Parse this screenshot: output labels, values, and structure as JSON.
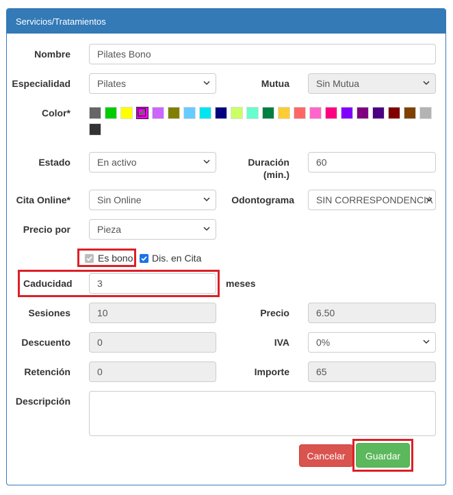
{
  "panel": {
    "title": "Servicios/Tratamientos"
  },
  "form": {
    "nombre": {
      "label": "Nombre",
      "value": "Pilates Bono"
    },
    "especialidad": {
      "label": "Especialidad",
      "value": "Pilates"
    },
    "mutua": {
      "label": "Mutua",
      "value": "Sin Mutua"
    },
    "color": {
      "label": "Color*",
      "selected": "#ff00ff",
      "swatches": [
        "#666666",
        "#00cc00",
        "#ffff00",
        "#ff00ff",
        "#cc66ff",
        "#808000",
        "#66ccff",
        "#00e5ee",
        "#000080",
        "#ccff66",
        "#66ffcc",
        "#008040",
        "#ffcc33",
        "#ff6666",
        "#ff66cc",
        "#ff0080",
        "#8000ff",
        "#800080",
        "#4b0082",
        "#800000",
        "#804000",
        "#b3b3b3",
        "#333333"
      ]
    },
    "estado": {
      "label": "Estado",
      "value": "En activo"
    },
    "duracion": {
      "label_line1": "Duración",
      "label_line2": "(min.)",
      "value": "60"
    },
    "cita_online": {
      "label": "Cita Online*",
      "value": "Sin Online"
    },
    "odontograma": {
      "label": "Odontograma",
      "value": "SIN CORRESPONDENCIA"
    },
    "precio_por": {
      "label": "Precio por",
      "value": "Pieza"
    },
    "es_bono": {
      "label": "Es bono",
      "checked": true
    },
    "dis_en_cita": {
      "label": "Dis. en Cita",
      "checked": true
    },
    "caducidad": {
      "label": "Caducidad",
      "value": "3",
      "suffix": "meses"
    },
    "sesiones": {
      "label": "Sesiones",
      "value": "10"
    },
    "precio": {
      "label": "Precio",
      "value": "6.50"
    },
    "descuento": {
      "label": "Descuento",
      "value": "0"
    },
    "iva": {
      "label": "IVA",
      "value": "0%"
    },
    "retencion": {
      "label": "Retención",
      "value": "0"
    },
    "importe": {
      "label": "Importe",
      "value": "65"
    },
    "descripcion": {
      "label": "Descripción",
      "value": ""
    }
  },
  "buttons": {
    "cancel": "Cancelar",
    "save": "Guardar"
  },
  "colors": {
    "primary": "#337ab7",
    "cancel": "#d9534f",
    "save": "#5cb85c",
    "highlight": "#dc1f26",
    "checkbox_active": "#1a73e8",
    "checkbox_disabled": "#bdbdbd"
  }
}
